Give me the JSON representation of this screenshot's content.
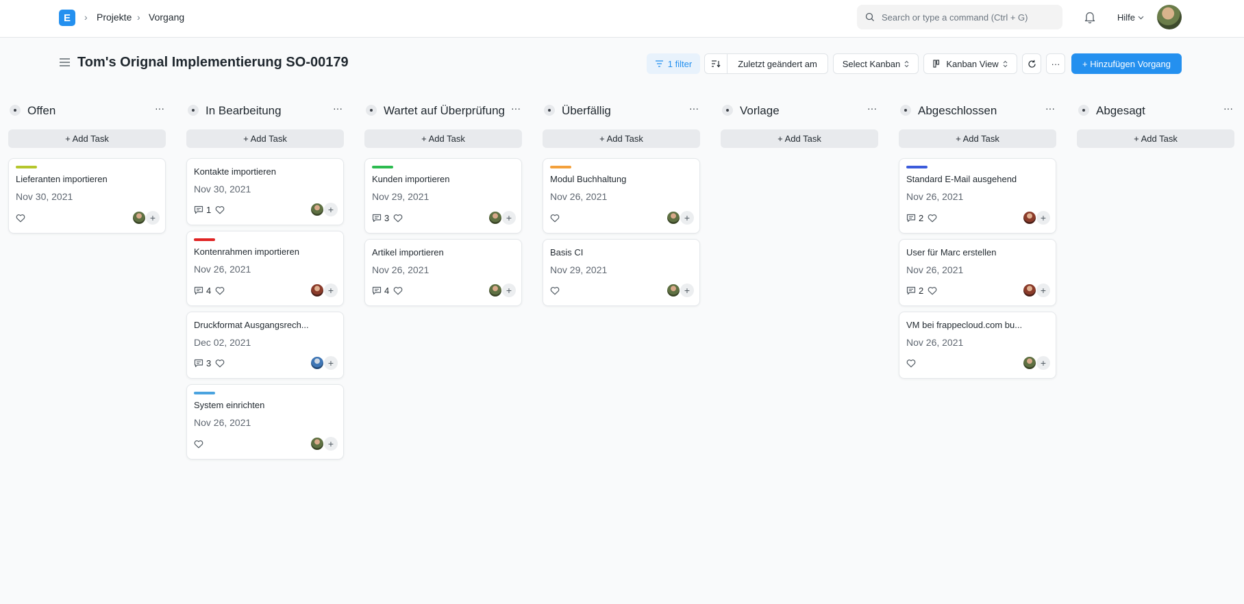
{
  "navbar": {
    "logo_letter": "E",
    "breadcrumbs": [
      "Projekte",
      "Vorgang"
    ],
    "search_placeholder": "Search or type a command (Ctrl + G)",
    "help_label": "Hilfe"
  },
  "page": {
    "title": "Tom's Orignal Implementierung SO-00179"
  },
  "toolbar": {
    "filter_label": "1 filter",
    "sort_label": "Zuletzt geändert am",
    "kanban_select_label": "Select Kanban",
    "view_label": "Kanban View",
    "more_label": "···",
    "add_label": "+ Hinzufügen Vorgang"
  },
  "colors": {
    "primary": "#2490ef",
    "olive": "#b5c62c",
    "red": "#e02424",
    "blue_light": "#4aa3df",
    "green": "#2cbb4f",
    "orange": "#f3a03b",
    "indigo": "#3b5bdb"
  },
  "board": {
    "add_task_label": "+ Add Task",
    "column_more": "···",
    "columns": [
      {
        "title": "Offen",
        "cards": [
          {
            "title": "Lieferanten importieren",
            "date": "Nov 30, 2021",
            "bar_color": "#b5c62c",
            "comments": "",
            "avatar": "green"
          }
        ]
      },
      {
        "title": "In Bearbeitung",
        "cards": [
          {
            "title": "Kontakte importieren",
            "date": "Nov 30, 2021",
            "bar_color": "",
            "comments": "1",
            "avatar": "green"
          },
          {
            "title": "Kontenrahmen importieren",
            "date": "Nov 26, 2021",
            "bar_color": "#e02424",
            "comments": "4",
            "avatar": "red"
          },
          {
            "title": "Druckformat Ausgangsrech...",
            "date": "Dec 02, 2021",
            "bar_color": "",
            "comments": "3",
            "avatar": "blue"
          },
          {
            "title": "System einrichten",
            "date": "Nov 26, 2021",
            "bar_color": "#4aa3df",
            "comments": "",
            "avatar": "green"
          }
        ]
      },
      {
        "title": "Wartet auf Überprüfung",
        "cards": [
          {
            "title": "Kunden importieren",
            "date": "Nov 29, 2021",
            "bar_color": "#2cbb4f",
            "comments": "3",
            "avatar": "green"
          },
          {
            "title": "Artikel importieren",
            "date": "Nov 26, 2021",
            "bar_color": "",
            "comments": "4",
            "avatar": "green"
          }
        ]
      },
      {
        "title": "Überfällig",
        "cards": [
          {
            "title": "Modul Buchhaltung",
            "date": "Nov 26, 2021",
            "bar_color": "#f3a03b",
            "comments": "",
            "avatar": "green"
          },
          {
            "title": "Basis CI",
            "date": "Nov 29, 2021",
            "bar_color": "",
            "comments": "",
            "avatar": "green"
          }
        ]
      },
      {
        "title": "Vorlage",
        "cards": []
      },
      {
        "title": "Abgeschlossen",
        "cards": [
          {
            "title": "Standard E-Mail ausgehend",
            "date": "Nov 26, 2021",
            "bar_color": "#3b5bdb",
            "comments": "2",
            "avatar": "red"
          },
          {
            "title": "User für Marc erstellen",
            "date": "Nov 26, 2021",
            "bar_color": "",
            "comments": "2",
            "avatar": "red"
          },
          {
            "title": "VM bei frappecloud.com bu...",
            "date": "Nov 26, 2021",
            "bar_color": "",
            "comments": "",
            "avatar": "green"
          }
        ]
      },
      {
        "title": "Abgesagt",
        "cards": []
      }
    ]
  }
}
